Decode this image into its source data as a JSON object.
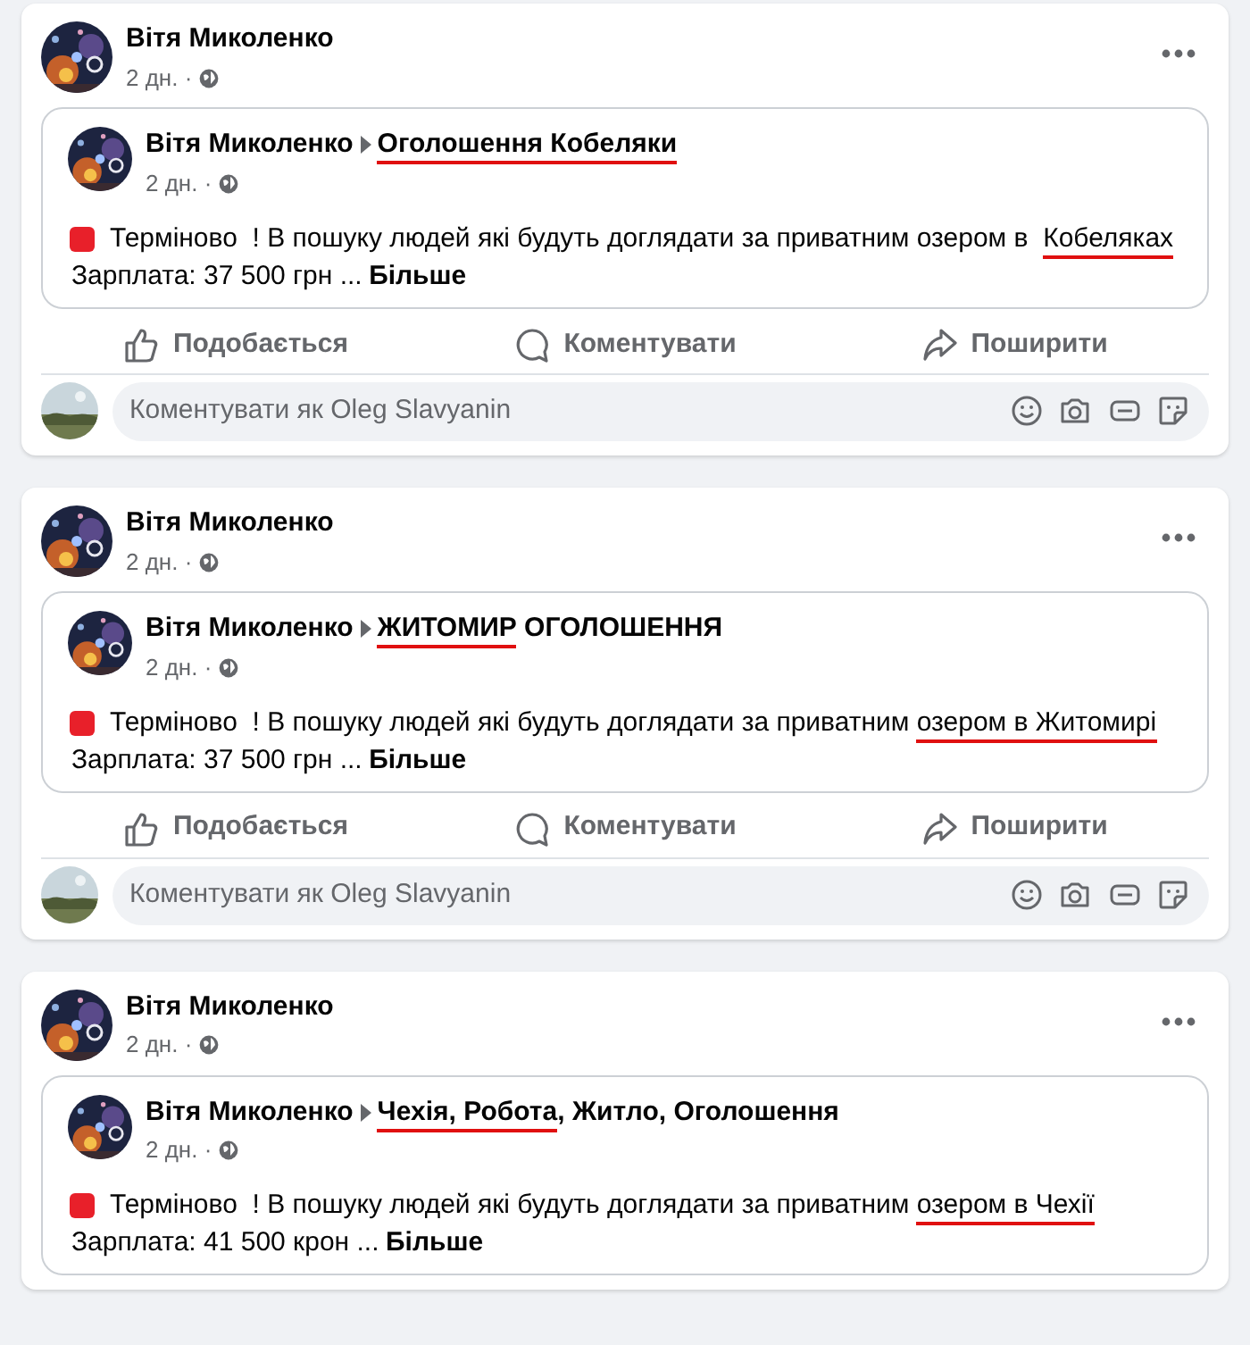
{
  "posts": [
    {
      "author": "Вітя Миколенко",
      "time": "2 дн. ·",
      "shared": {
        "author": "Вітя Миколенко",
        "time": "2 дн. ·",
        "group": [
          {
            "text": "Оголошення Кобеляки",
            "underlined": true
          }
        ],
        "body": [
          {
            "text": "Терміново  ! В пошуку людей які будуть доглядати за приватним озером в  ",
            "underlined": false
          },
          {
            "text": "Кобеляках",
            "underlined": true
          }
        ],
        "salary": "Зарплата: 37 500 грн ...",
        "more": "Більше"
      },
      "actions": [
        "Подобається",
        "Коментувати",
        "Поширити"
      ],
      "comment_placeholder": "Коментувати як Oleg Slavyanin"
    },
    {
      "author": "Вітя Миколенко",
      "time": "2 дн. ·",
      "shared": {
        "author": "Вітя Миколенко",
        "time": "2 дн. ·",
        "group": [
          {
            "text": "ЖИТОМИР",
            "underlined": true
          },
          {
            "text": " ОГОЛОШЕННЯ",
            "underlined": false
          }
        ],
        "body": [
          {
            "text": "Терміново  ! В пошуку людей які будуть доглядати за приватним ",
            "underlined": false
          },
          {
            "text": "озером в Житомирі",
            "underlined": true
          }
        ],
        "salary": "Зарплата: 37 500 грн ...",
        "more": "Більше"
      },
      "actions": [
        "Подобається",
        "Коментувати",
        "Поширити"
      ],
      "comment_placeholder": "Коментувати як Oleg Slavyanin"
    },
    {
      "author": "Вітя Миколенко",
      "time": "2 дн. ·",
      "shared": {
        "author": "Вітя Миколенко",
        "time": "2 дн. ·",
        "group": [
          {
            "text": "Чехія, Робота",
            "underlined": true
          },
          {
            "text": ", Житло, Оголошення",
            "underlined": false
          }
        ],
        "body": [
          {
            "text": "Терміново  ! В пошуку людей які будуть доглядати за приватним ",
            "underlined": false
          },
          {
            "text": "озером в Чехії",
            "underlined": true
          }
        ],
        "salary": "Зарплата: 41 500 крон ...",
        "more": "Більше"
      }
    }
  ]
}
